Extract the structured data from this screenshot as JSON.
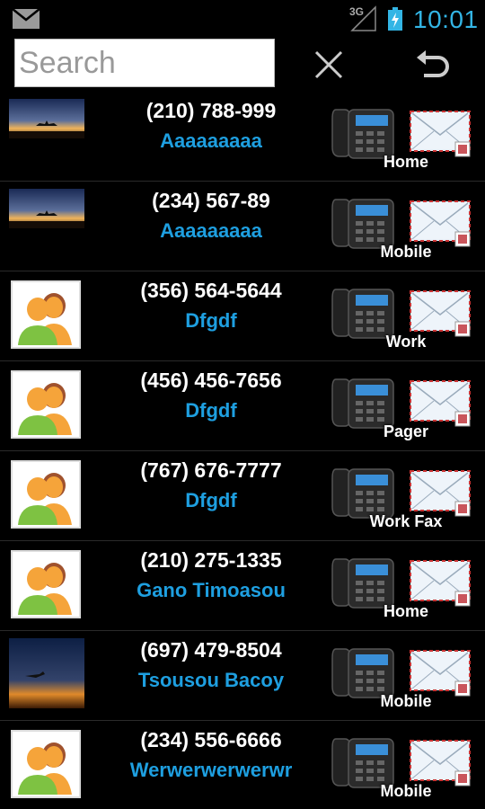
{
  "status_bar": {
    "network": "3G",
    "time": "10:01",
    "icons": [
      "mail-icon",
      "signal-icon",
      "battery-charging-icon"
    ]
  },
  "search": {
    "placeholder": "Search",
    "value": "",
    "clear_icon": "close-icon",
    "back_icon": "undo-arrow-icon"
  },
  "contacts": [
    {
      "phone": "(210) 788-999",
      "name": "Aaaaaaaaa",
      "type": "Home",
      "avatar": "sunset-photo"
    },
    {
      "phone": "(234) 567-89",
      "name": "Aaaaaaaaa",
      "type": "Mobile",
      "avatar": "sunset-photo"
    },
    {
      "phone": "(356) 564-5644",
      "name": "Dfgdf",
      "type": "Work",
      "avatar": "default-contact"
    },
    {
      "phone": "(456) 456-7656",
      "name": "Dfgdf",
      "type": "Pager",
      "avatar": "default-contact"
    },
    {
      "phone": "(767) 676-7777",
      "name": "Dfgdf",
      "type": "Work Fax",
      "avatar": "default-contact"
    },
    {
      "phone": "(210) 275-1335",
      "name": "Gano Timoasou",
      "type": "Home",
      "avatar": "default-contact"
    },
    {
      "phone": "(697) 479-8504",
      "name": "Tsousou Bacoy",
      "type": "Mobile",
      "avatar": "plane-sunset-photo"
    },
    {
      "phone": "(234) 556-6666",
      "name": "Werwerwerwerwr",
      "type": "Mobile",
      "avatar": "default-contact"
    }
  ],
  "colors": {
    "accent": "#33b5e5",
    "name_text": "#1e9fe0",
    "background": "#000000"
  }
}
